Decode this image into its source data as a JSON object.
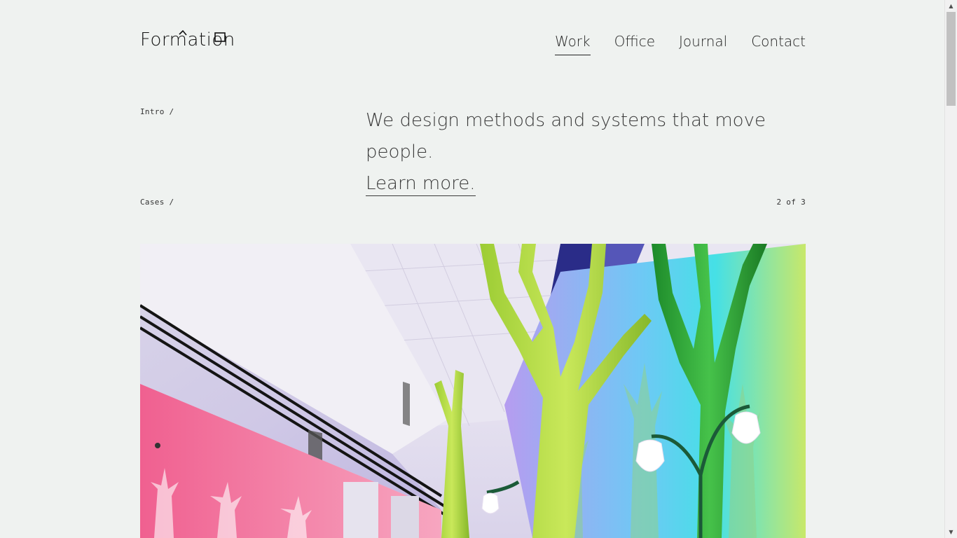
{
  "brand": {
    "name": "Formation"
  },
  "nav": {
    "items": [
      {
        "label": "Work",
        "active": true
      },
      {
        "label": "Office",
        "active": false
      },
      {
        "label": "Journal",
        "active": false
      },
      {
        "label": "Contact",
        "active": false
      }
    ]
  },
  "intro": {
    "label": "Intro /",
    "headline": "We design methods and systems that move people.",
    "link": "Learn more."
  },
  "cases": {
    "label": "Cases /",
    "pager": "2 of 3"
  },
  "hero": {
    "image_desc_icon": "hero-image",
    "colors": {
      "pink": "#f05a8c",
      "green": "#7cc23c",
      "teal": "#38c7c8",
      "purple": "#7a6ae0"
    }
  }
}
